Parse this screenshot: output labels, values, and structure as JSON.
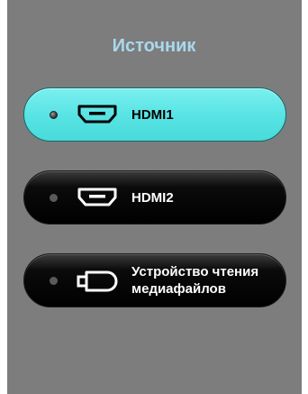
{
  "title": "Источник",
  "sources": [
    {
      "label": "HDMI1",
      "icon": "hdmi-port-icon",
      "selected": true
    },
    {
      "label": "HDMI2",
      "icon": "hdmi-port-icon",
      "selected": false
    },
    {
      "label_line1": "Устройство чтения",
      "label_line2": "медиафайлов",
      "icon": "usb-port-icon",
      "selected": false
    }
  ],
  "colors": {
    "panel_background": "#7d7d7d",
    "title": "#a9d8ee",
    "selected_button": "#5ee6e6",
    "normal_button": "#000000"
  }
}
